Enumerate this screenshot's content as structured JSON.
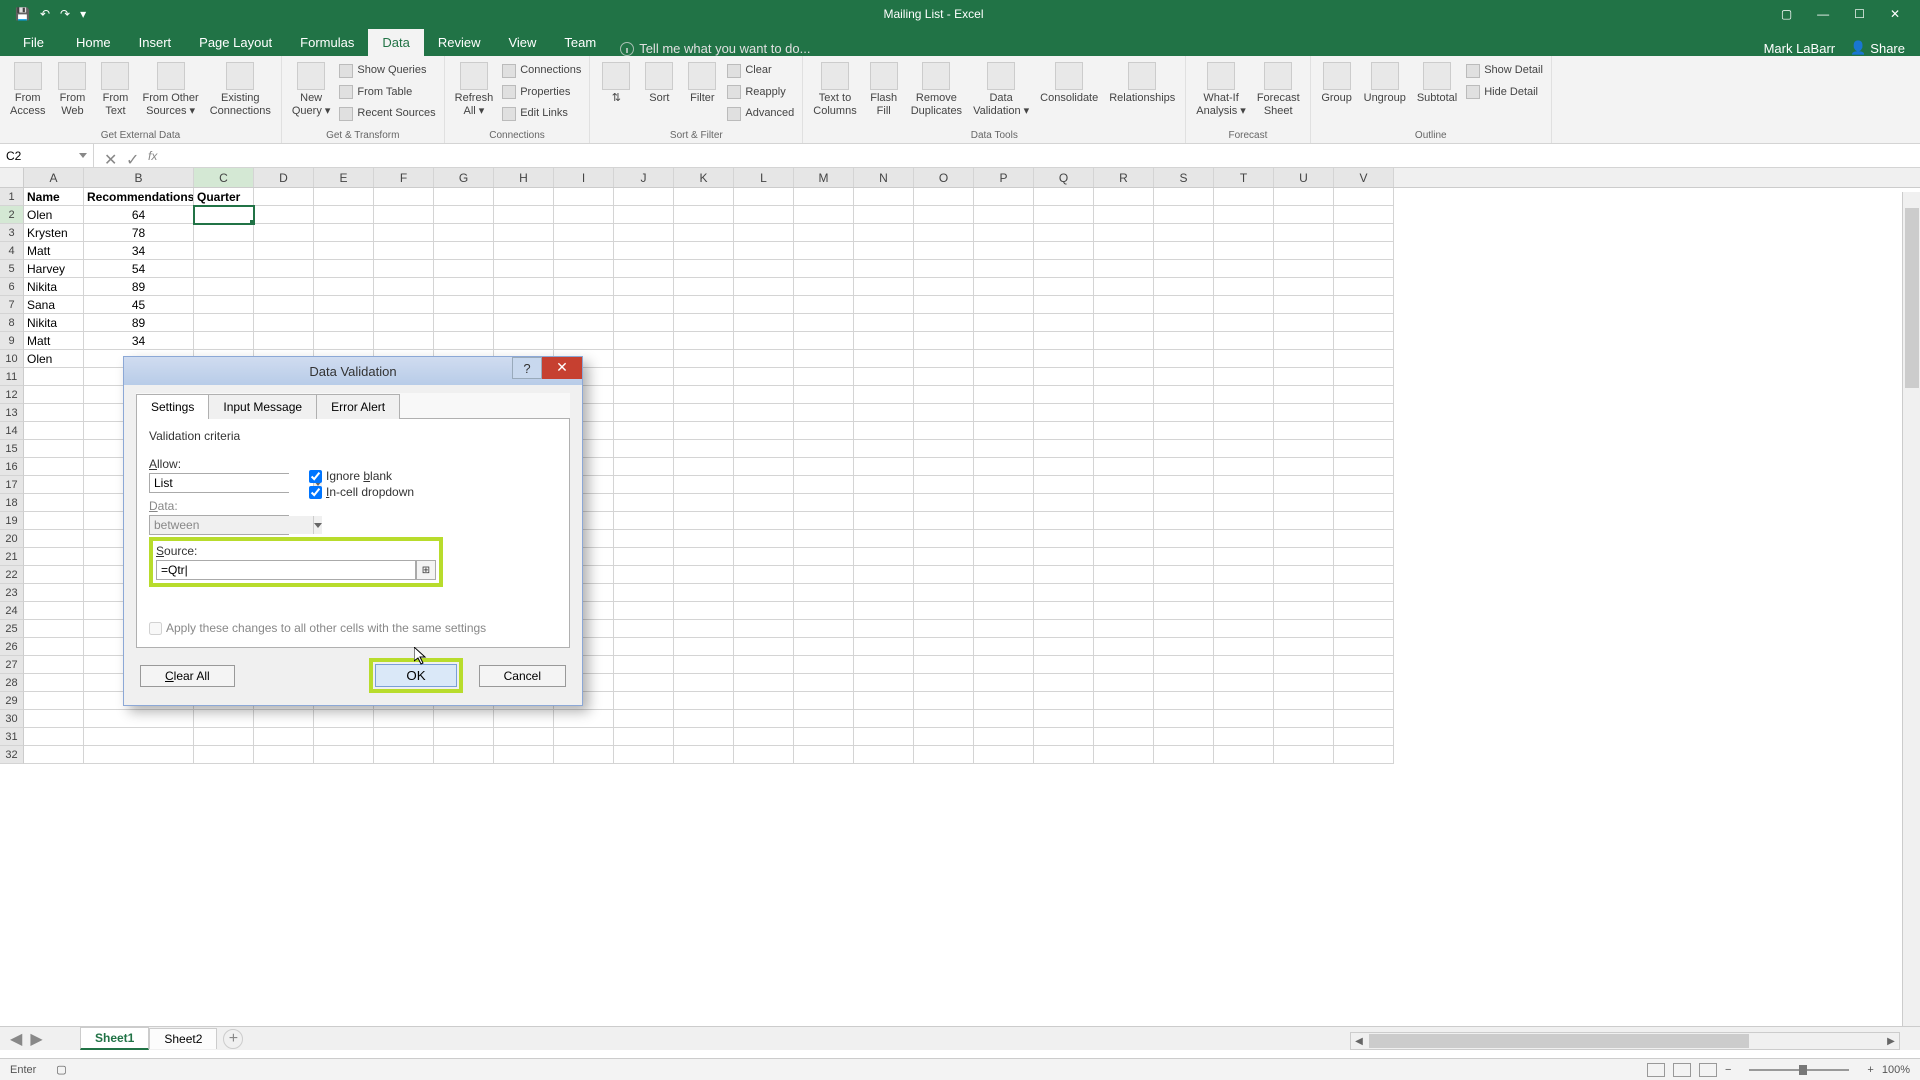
{
  "app": {
    "title": "Mailing List - Excel",
    "user": "Mark LaBarr",
    "share": "Share"
  },
  "tabs": {
    "file": "File",
    "list": [
      "Home",
      "Insert",
      "Page Layout",
      "Formulas",
      "Data",
      "Review",
      "View",
      "Team"
    ],
    "active": "Data",
    "tellme": "Tell me what you want to do..."
  },
  "ribbon": {
    "groups": [
      {
        "label": "Get External Data",
        "large": [
          "From\nAccess",
          "From\nWeb",
          "From\nText",
          "From Other\nSources ▾",
          "Existing\nConnections"
        ],
        "small": []
      },
      {
        "label": "Get & Transform",
        "large": [
          "New\nQuery ▾"
        ],
        "small": [
          "Show Queries",
          "From Table",
          "Recent Sources"
        ]
      },
      {
        "label": "Connections",
        "large": [
          "Refresh\nAll ▾"
        ],
        "small": [
          "Connections",
          "Properties",
          "Edit Links"
        ]
      },
      {
        "label": "Sort & Filter",
        "large": [
          "⇅",
          "Sort",
          "Filter"
        ],
        "small": [
          "Clear",
          "Reapply",
          "Advanced"
        ]
      },
      {
        "label": "Data Tools",
        "large": [
          "Text to\nColumns",
          "Flash\nFill",
          "Remove\nDuplicates",
          "Data\nValidation ▾",
          "Consolidate",
          "Relationships"
        ],
        "small": []
      },
      {
        "label": "Forecast",
        "large": [
          "What-If\nAnalysis ▾",
          "Forecast\nSheet"
        ],
        "small": []
      },
      {
        "label": "Outline",
        "large": [
          "Group",
          "Ungroup",
          "Subtotal"
        ],
        "small": [
          "Show Detail",
          "Hide Detail"
        ]
      }
    ]
  },
  "namebox": "C2",
  "grid": {
    "headers": [
      "Name",
      "Recommendations",
      "Quarter"
    ],
    "rows": [
      [
        "Olen",
        "64",
        ""
      ],
      [
        "Krysten",
        "78",
        ""
      ],
      [
        "Matt",
        "34",
        ""
      ],
      [
        "Harvey",
        "54",
        ""
      ],
      [
        "Nikita",
        "89",
        ""
      ],
      [
        "Sana",
        "45",
        ""
      ],
      [
        "Nikita",
        "89",
        ""
      ],
      [
        "Matt",
        "34",
        ""
      ],
      [
        "Olen",
        "",
        ""
      ]
    ],
    "cols": [
      "A",
      "B",
      "C",
      "D",
      "E",
      "F",
      "G",
      "H",
      "I",
      "J",
      "K",
      "L",
      "M",
      "N",
      "O",
      "P",
      "Q",
      "R",
      "S",
      "T",
      "U",
      "V"
    ]
  },
  "dialog": {
    "title": "Data Validation",
    "tabs": [
      "Settings",
      "Input Message",
      "Error Alert"
    ],
    "criteria_label": "Validation criteria",
    "allow_label": "Allow:",
    "allow_value": "List",
    "data_label": "Data:",
    "data_value": "between",
    "source_label": "Source:",
    "source_value": "=Qtr|",
    "ignore_blank": "Ignore blank",
    "incell": "In-cell dropdown",
    "apply_all": "Apply these changes to all other cells with the same settings",
    "clear_all": "Clear All",
    "ok": "OK",
    "cancel": "Cancel"
  },
  "sheets": {
    "active": "Sheet1",
    "list": [
      "Sheet1",
      "Sheet2"
    ]
  },
  "status": {
    "mode": "Enter",
    "zoom": "100%"
  }
}
